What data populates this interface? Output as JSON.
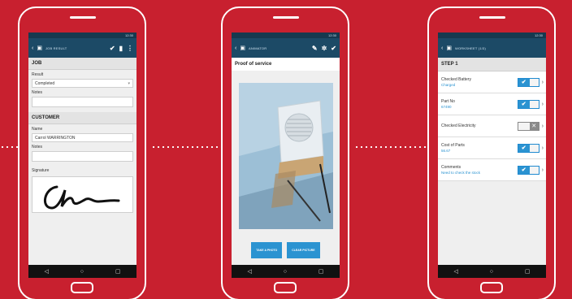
{
  "phone1": {
    "title": "JOB RESULT",
    "section_job": "JOB",
    "result_label": "Result",
    "result_value": "Completed",
    "notes_label": "Notes",
    "section_customer": "CUSTOMER",
    "name_label": "Name",
    "name_value": "Carrol WARRINGTON",
    "notes_label_2": "Notes",
    "signature_label": "Signature"
  },
  "phone2": {
    "title": "ANIMATOR",
    "heading": "Proof of service",
    "take_photo": "TAKE A PHOTO",
    "clear_picture": "CLEAR PICTURE"
  },
  "phone3": {
    "title": "WORKSHEET (1/3)",
    "step": "STEP 1",
    "rows": [
      {
        "title": "Checked Battery",
        "value": "Charged",
        "checked": true
      },
      {
        "title": "Part No",
        "value": "67490",
        "checked": true
      },
      {
        "title": "Checked Electricity",
        "value": "",
        "checked": false
      },
      {
        "title": "Cost of Parts",
        "value": "56.67",
        "checked": true
      },
      {
        "title": "Comments",
        "value": "Need to check the stock",
        "checked": true
      }
    ]
  },
  "status_time": "12:30",
  "icons": [
    "calendar-icon",
    "check-icon",
    "trash-icon",
    "menu-dots-icon",
    "pencil-icon",
    "gear-icon",
    "back-icon",
    "home-icon",
    "recents-icon",
    "chevron-right-icon",
    "dropdown-arrow-icon"
  ],
  "colors": {
    "background": "#c8202f",
    "appbar": "#1c4a66",
    "accent": "#2b93d1"
  }
}
